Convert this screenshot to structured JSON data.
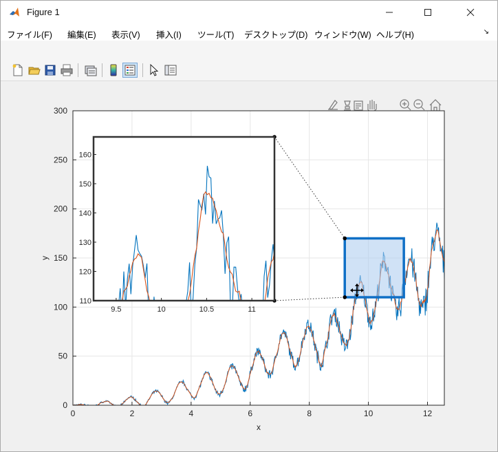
{
  "window": {
    "title": "Figure 1"
  },
  "menu": [
    {
      "label": "ファイル(F)",
      "shortcut": "F"
    },
    {
      "label": "編集(E)",
      "shortcut": "E"
    },
    {
      "label": "表示(V)",
      "shortcut": "V"
    },
    {
      "label": "挿入(I)",
      "shortcut": "I"
    },
    {
      "label": "ツール(T)",
      "shortcut": "T"
    },
    {
      "label": "デスクトップ(D)",
      "shortcut": "D"
    },
    {
      "label": "ウィンドウ(W)",
      "shortcut": "W"
    },
    {
      "label": "ヘルプ(H)",
      "shortcut": "H"
    }
  ],
  "toolbar_icons": [
    "new-figure-icon",
    "open-file-icon",
    "save-icon",
    "print-icon",
    "link-plot-icon",
    "colorbar-icon",
    "legend-icon",
    "pointer-icon",
    "property-inspector-icon"
  ],
  "axes_toolbar_icons": [
    "brush-icon",
    "data-tip-icon",
    "restore-icon",
    "pan-icon",
    "zoom-in-icon",
    "zoom-out-icon",
    "home-icon"
  ],
  "colors": {
    "series_blue": "#0072bd",
    "series_red": "#d95319",
    "selection_fill": "#a9cbee",
    "selection_border": "#0f6fc6"
  },
  "chart_data": {
    "type": "line",
    "xlabel": "x",
    "ylabel": "y",
    "xlim": [
      0,
      12.57
    ],
    "ylim": [
      0,
      300
    ],
    "xticks": [
      0,
      2,
      4,
      6,
      8,
      10,
      12
    ],
    "yticks": [
      0,
      50,
      100,
      150,
      200,
      250,
      300
    ],
    "grid": true,
    "series": [
      {
        "kind": "noisy",
        "color": "#0072bd",
        "model": "y = x^2 * (1 + 0.1*sin(2x)) with noise"
      },
      {
        "kind": "smoothed",
        "color": "#d95319"
      }
    ],
    "zoom_region": {
      "xlim": [
        9.2,
        11.2
      ],
      "ylim": [
        110,
        170
      ]
    },
    "inset": {
      "xlim": [
        9.25,
        11.25
      ],
      "ylim": [
        110,
        166
      ],
      "xticks": [
        9.5,
        10,
        10.5,
        11
      ],
      "xtick_labels": [
        "9.5",
        "10",
        "10.5",
        "11"
      ],
      "yticks": [
        110,
        120,
        130,
        140,
        150,
        160
      ],
      "ytick_labels": [
        "110",
        "120",
        "130",
        "140",
        "150",
        "160"
      ]
    }
  }
}
